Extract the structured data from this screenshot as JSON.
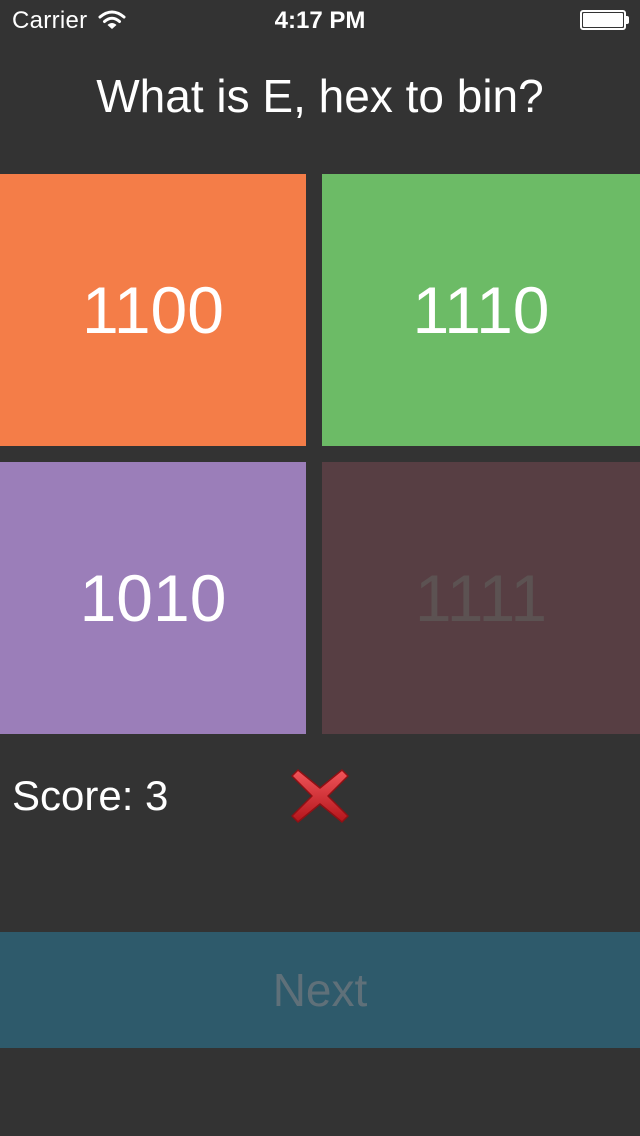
{
  "status_bar": {
    "carrier": "Carrier",
    "time": "4:17 PM",
    "wifi_icon": "wifi-icon",
    "battery_icon": "battery-icon"
  },
  "question": {
    "text": "What is E, hex to bin?"
  },
  "answers": [
    {
      "label": "1100",
      "color": "#f47d48"
    },
    {
      "label": "1110",
      "color": "#6cbb66"
    },
    {
      "label": "1010",
      "color": "#9b7eb9"
    },
    {
      "label": "1111",
      "color": "#573e43"
    }
  ],
  "score": {
    "text": "Score: 3"
  },
  "result": {
    "icon": "cross-mark-icon",
    "color": "#d8262b"
  },
  "next_button": {
    "label": "Next",
    "color": "#2e5a6b"
  },
  "colors": {
    "background": "#333333"
  }
}
